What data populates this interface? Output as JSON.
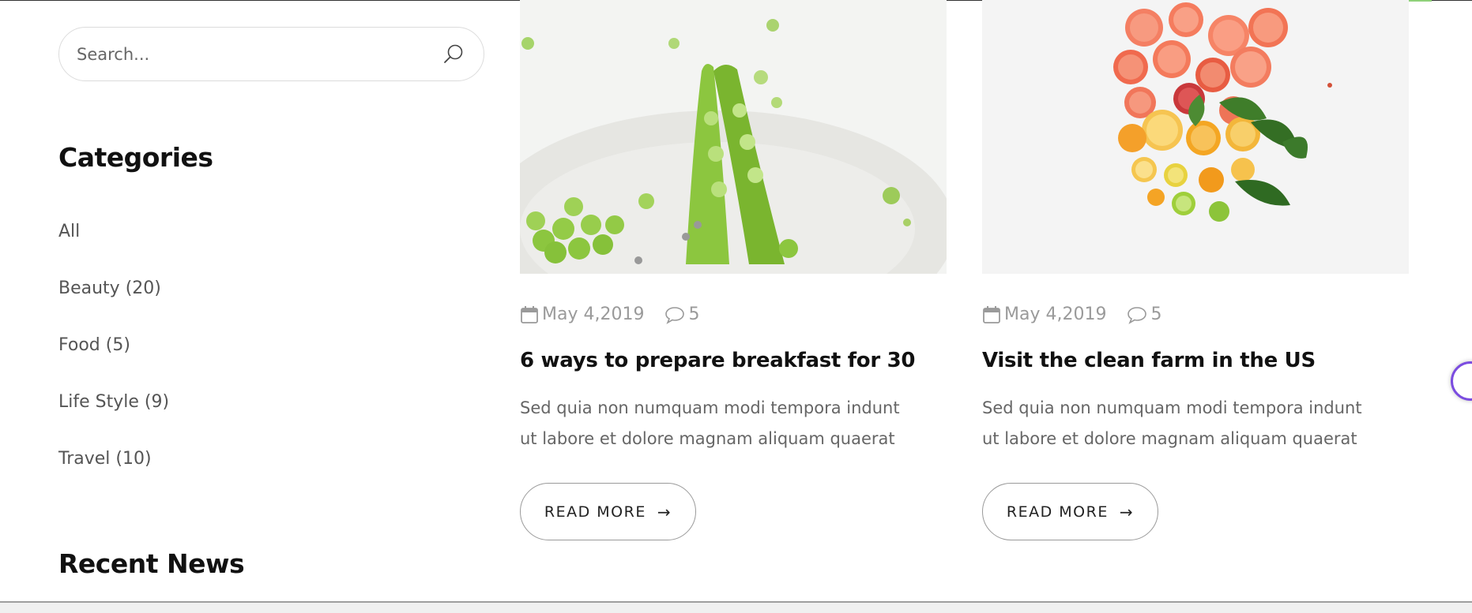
{
  "search": {
    "placeholder": "Search..."
  },
  "sidebar": {
    "categories_heading": "Categories",
    "categories": [
      {
        "label": "All"
      },
      {
        "label": "Beauty (20)"
      },
      {
        "label": "Food (5)"
      },
      {
        "label": "Life Style (9)"
      },
      {
        "label": "Travel (10)"
      }
    ],
    "recent_heading": "Recent News"
  },
  "posts": [
    {
      "date": "May 4,2019",
      "comments": "5",
      "title": "6 ways to prepare breakfast for 30",
      "excerpt": "Sed quia non numquam modi tempora indunt ut labore et dolore magnam aliquam quaerat",
      "button": "READ MORE",
      "image_icon": "green-peas-photo"
    },
    {
      "date": "May 4,2019",
      "comments": "5",
      "title": "Visit the clean farm in the US",
      "excerpt": "Sed quia non numquam modi tempora indunt ut labore et dolore magnam aliquam quaerat",
      "button": "READ MORE",
      "image_icon": "citrus-fruits-photo"
    }
  ],
  "colors": {
    "accent_green": "#8fd17a",
    "widget_purple": "#7b4ce0",
    "meta_gray": "#9a9a9a"
  }
}
